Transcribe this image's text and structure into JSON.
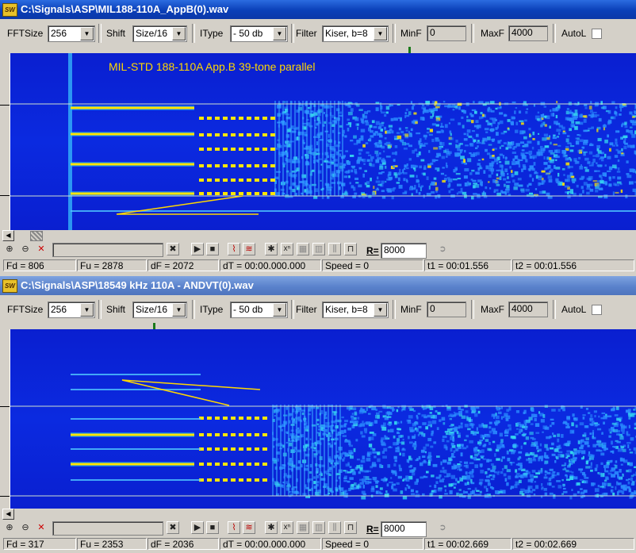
{
  "windows": [
    {
      "title": "C:\\Signals\\ASP\\MIL188-110A_AppB(0).wav",
      "icon_text": "SW",
      "annotation": "MIL-STD 188-110A App.B 39-tone parallel",
      "toolbar": {
        "fftsize_label": "FFTSize",
        "fftsize_value": "256",
        "shift_label": "Shift",
        "shift_value": "Size/16",
        "itype_label": "IType",
        "itype_value": "- 50 db",
        "filter_label": "Filter",
        "filter_value": "Kiser, b=8",
        "minf_label": "MinF",
        "minf_value": "0",
        "maxf_label": "MaxF",
        "maxf_value": "4000",
        "autol_label": "AutoL"
      },
      "r_label": "R=",
      "r_value": "8000",
      "status": {
        "fd": "Fd = 806",
        "fu": "Fu = 2878",
        "df": "dF = 2072",
        "dt": "dT = 00:00.000.000",
        "speed": "Speed = 0",
        "t1": "t1 = 00:01.556",
        "t2": "t2 = 00:01.556"
      }
    },
    {
      "title": "C:\\Signals\\ASP\\18549 kHz 110A - ANDVT(0).wav",
      "icon_text": "SW",
      "toolbar": {
        "fftsize_label": "FFTSize",
        "fftsize_value": "256",
        "shift_label": "Shift",
        "shift_value": "Size/16",
        "itype_label": "IType",
        "itype_value": "- 50 db",
        "filter_label": "Filter",
        "filter_value": "Kiser, b=8",
        "minf_label": "MinF",
        "minf_value": "0",
        "maxf_label": "MaxF",
        "maxf_value": "4000",
        "autol_label": "AutoL"
      },
      "r_label": "R=",
      "r_value": "8000",
      "status": {
        "fd": "Fd = 317",
        "fu": "Fu = 2353",
        "df": "dF = 2036",
        "dt": "dT = 00:00.000.000",
        "speed": "Speed = 0",
        "t1": "t1 = 00:02.669",
        "t2": "t2 = 00:02.669"
      }
    }
  ],
  "colors": {
    "spectrum_bg": "#0a23d8",
    "tone": "#ffe600",
    "cursor": "#c8d8c8",
    "annotation": "#ffd700"
  },
  "icons": [
    "zoom-in-icon",
    "zoom-out-icon",
    "zoom-reset-icon",
    "cross-icon",
    "play-icon",
    "stop-icon",
    "spectrum-icon",
    "waterfall-icon",
    "marker-icon",
    "power-icon",
    "filter-icon",
    "bars-icon",
    "comb-icon",
    "pulse-icon",
    "go-icon"
  ]
}
